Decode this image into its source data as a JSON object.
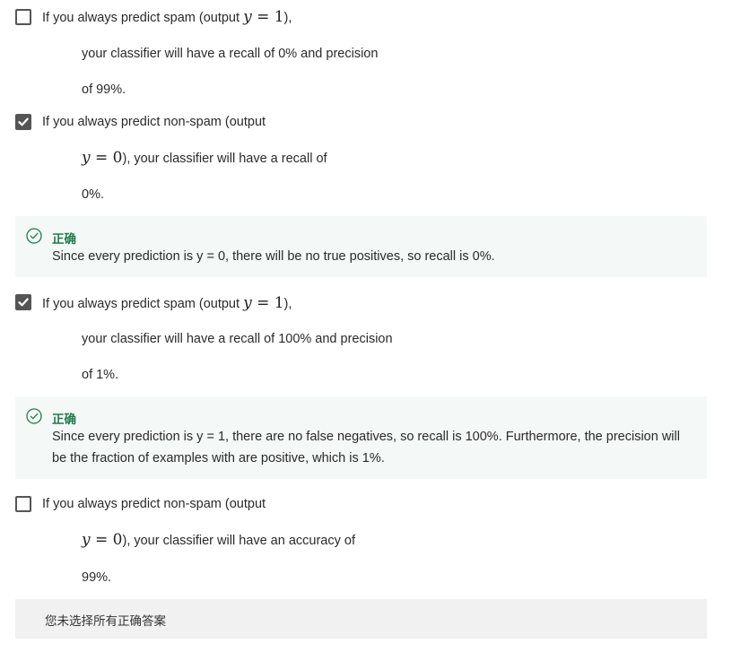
{
  "options": [
    {
      "checked": false,
      "line1_pre": "If you always predict spam (output ",
      "line1_math": "y = 1",
      "line1_post": "),",
      "line2": "your classifier will have a recall of 0% and precision",
      "line3": "of 99%."
    },
    {
      "checked": true,
      "line1": "If you always predict non-spam (output",
      "line2_math": "y = 0",
      "line2_post": "), your classifier will have a recall of",
      "line3": "0%.",
      "feedback": {
        "label": "正确",
        "text": "Since every prediction is y = 0, there will be no true positives, so recall is 0%."
      }
    },
    {
      "checked": true,
      "line1_pre": "If you always predict spam (output ",
      "line1_math": "y = 1",
      "line1_post": "),",
      "line2": "your classifier will have a recall of 100% and precision",
      "line3": "of 1%.",
      "feedback": {
        "label": "正确",
        "text_line1": "Since every prediction is y = 1, there are no false negatives, so recall is 100%. Furthermore, the precision will",
        "text_line2": "be the fraction of examples with are positive, which is 1%."
      }
    },
    {
      "checked": false,
      "line1": "If you always predict non-spam (output",
      "line2_math": "y = 0",
      "line2_post": "), your classifier will have an accuracy of",
      "line3": "99%."
    }
  ],
  "summary": "您未选择所有正确答案",
  "colors": {
    "checkbox": "#555555",
    "feedback_bg": "#f4f8f6",
    "correct_green": "#1e7b4f",
    "summary_bg": "#f1f1f1"
  }
}
